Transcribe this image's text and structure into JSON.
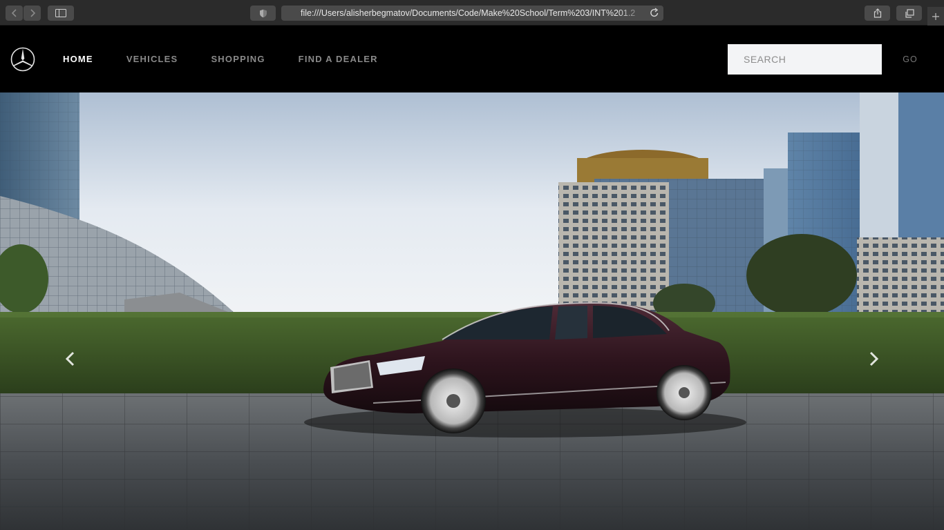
{
  "browser": {
    "url": "file:///Users/alisherbegmatov/Documents/Code/Make%20School/Term%203/INT%201.2"
  },
  "header": {
    "logo": "mercedes-star-logo",
    "nav": [
      {
        "label": "HOME",
        "active": true
      },
      {
        "label": "VEHICLES",
        "active": false
      },
      {
        "label": "SHOPPING",
        "active": false
      },
      {
        "label": "FIND A DEALER",
        "active": false
      }
    ],
    "search": {
      "placeholder": "SEARCH",
      "value": ""
    },
    "go_label": "GO"
  },
  "hero": {
    "image": "maybach-sedan-city-plaza",
    "prev_icon": "chevron-left-icon",
    "next_icon": "chevron-right-icon"
  },
  "colors": {
    "header_bg": "#000000",
    "nav_active": "#ffffff",
    "nav_inactive": "#8a8a8a",
    "search_bg": "#f3f4f6",
    "car_body": "#3a1a26"
  }
}
